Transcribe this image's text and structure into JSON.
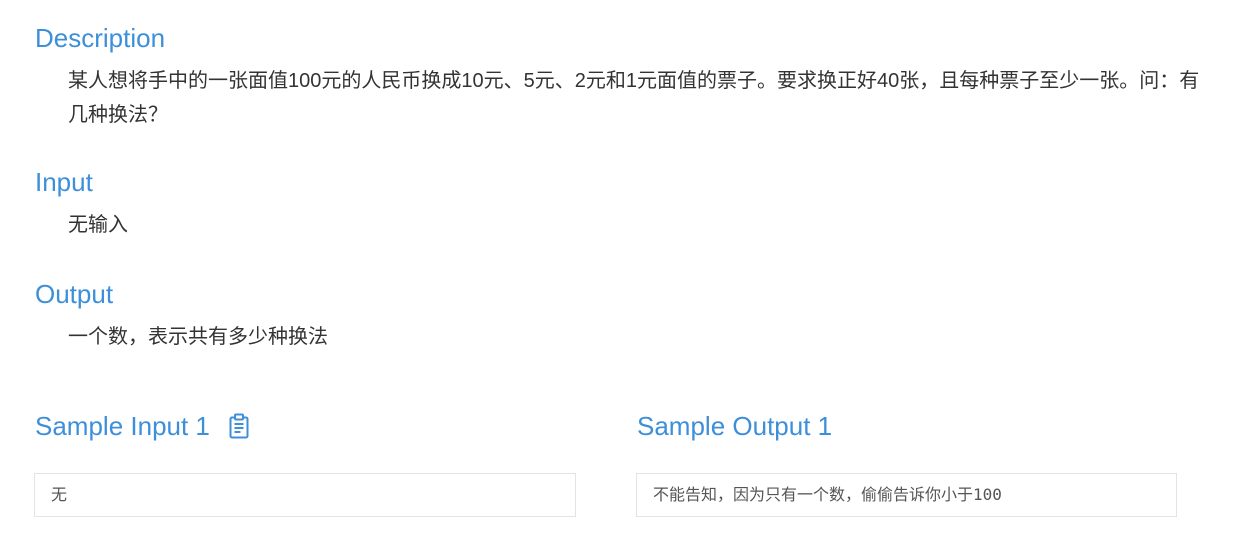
{
  "description": {
    "title": "Description",
    "text": "某人想将手中的一张面值100元的人民币换成10元、5元、2元和1元面值的票子。要求换正好40张，且每种票子至少一张。问：有几种换法？"
  },
  "input": {
    "title": "Input",
    "text": "无输入"
  },
  "output": {
    "title": "Output",
    "text": "一个数，表示共有多少种换法"
  },
  "sample_input": {
    "title": "Sample Input 1",
    "copy_icon": "clipboard-icon",
    "content": "无"
  },
  "sample_output": {
    "title": "Sample Output 1",
    "content": "不能告知，因为只有一个数，偷偷告诉你小于100"
  },
  "colors": {
    "accent": "#3d8fd9",
    "text": "#333333",
    "box_border": "#e3e3e3"
  }
}
